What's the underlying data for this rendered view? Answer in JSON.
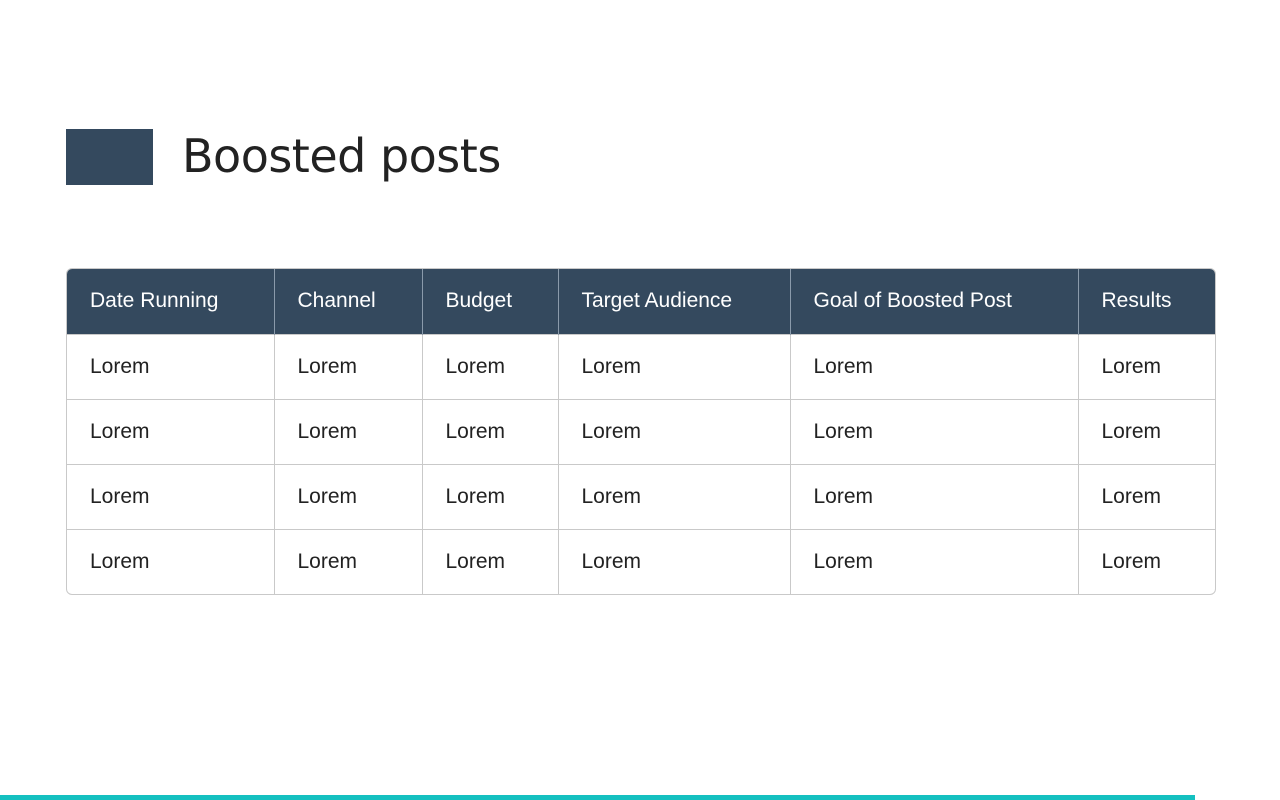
{
  "title": "Boosted posts",
  "colors": {
    "accent": "#34495e",
    "bottom_bar": "#14c0c0"
  },
  "table": {
    "headers": [
      "Date Running",
      "Channel",
      "Budget",
      "Target Audience",
      "Goal of Boosted Post",
      "Results"
    ],
    "rows": [
      [
        "Lorem",
        "Lorem",
        "Lorem",
        "Lorem",
        "Lorem",
        "Lorem"
      ],
      [
        "Lorem",
        "Lorem",
        "Lorem",
        "Lorem",
        "Lorem",
        "Lorem"
      ],
      [
        "Lorem",
        "Lorem",
        "Lorem",
        "Lorem",
        "Lorem",
        "Lorem"
      ],
      [
        "Lorem",
        "Lorem",
        "Lorem",
        "Lorem",
        "Lorem",
        "Lorem"
      ]
    ]
  }
}
